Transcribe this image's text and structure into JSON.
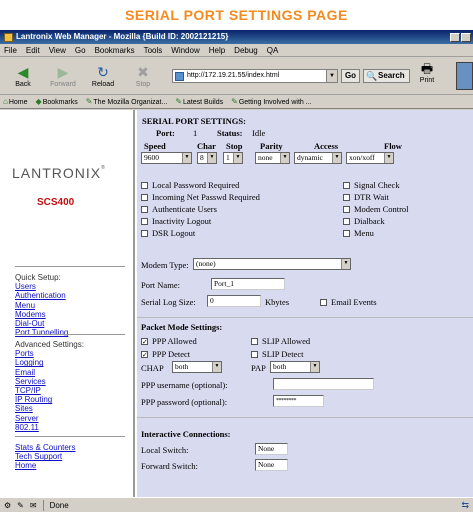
{
  "banner": "SERIAL PORT SETTINGS PAGE",
  "window": {
    "title": "Lantronix Web Manager - Mozilla {Build ID: 2002121215}"
  },
  "menu": [
    "File",
    "Edit",
    "View",
    "Go",
    "Bookmarks",
    "Tools",
    "Window",
    "Help",
    "Debug",
    "QA"
  ],
  "toolbar": {
    "back": "Back",
    "forward": "Forward",
    "reload": "Reload",
    "stop": "Stop",
    "url": "http://172.19.21.55/index.html",
    "go": "Go",
    "search": "Search",
    "print": "Print"
  },
  "bookmarks": [
    "Home",
    "Bookmarks",
    "The Mozilla Organizat...",
    "Latest Builds",
    "Getting Involved with ..."
  ],
  "sidebar": {
    "logo": "LANTRONIX",
    "model": "SCS400",
    "quick_setup": {
      "heading": "Quick Setup:",
      "links": [
        "Users",
        "Authentication",
        "Menu",
        "Modems",
        "Dial-Out",
        "Port Tunnelling"
      ]
    },
    "advanced": {
      "heading": "Advanced Settings:",
      "links": [
        "Ports",
        "Logging",
        "Email",
        "Services",
        "TCP/IP",
        "IP Routing",
        "Sites",
        "Server",
        "802.11"
      ]
    },
    "extra_links": [
      "Stats & Counters",
      "Tech Support",
      "Home"
    ]
  },
  "form": {
    "title": "SERIAL PORT SETTINGS:",
    "port_label": "Port:",
    "port_value": "1",
    "status_label": "Status:",
    "status_value": "Idle",
    "col_speed": "Speed",
    "col_char": "Char",
    "col_stop": "Stop",
    "col_parity": "Parity",
    "col_access": "Access",
    "col_flow": "Flow",
    "speed": "9600",
    "char": "8",
    "stop": "1",
    "parity": "none",
    "access": "dynamic",
    "flow": "xon/xoff",
    "checks_left": [
      {
        "label": "Local Password Required",
        "checked": false
      },
      {
        "label": "Incoming Net Passwd Required",
        "checked": false
      },
      {
        "label": "Authenticate Users",
        "checked": false
      },
      {
        "label": "Inactivity Logout",
        "checked": false
      },
      {
        "label": "DSR Logout",
        "checked": false
      }
    ],
    "checks_right": [
      {
        "label": "Signal Check",
        "checked": false
      },
      {
        "label": "DTR Wait",
        "checked": false
      },
      {
        "label": "Modem Control",
        "checked": false
      },
      {
        "label": "Dialback",
        "checked": false
      },
      {
        "label": "Menu",
        "checked": false
      }
    ],
    "modem_type_label": "Modem Type:",
    "modem_type": "(none)",
    "port_name_label": "Port Name:",
    "port_name": "Port_1",
    "log_size_label": "Serial Log Size:",
    "log_size": "0",
    "log_unit": "Kbytes",
    "email_events": "Email Events",
    "packet_title": "Packet Mode Settings:",
    "ppp_allowed": "PPP Allowed",
    "slip_allowed": "SLIP Allowed",
    "ppp_detect": "PPP Detect",
    "slip_detect": "SLIP Detect",
    "chap_label": "CHAP",
    "chap": "both",
    "pap_label": "PAP",
    "pap": "both",
    "ppp_user_label": "PPP username (optional):",
    "ppp_user": "",
    "ppp_pass_label": "PPP password (optional):",
    "ppp_pass": "********",
    "interactive_title": "Interactive Connections:",
    "local_switch_label": "Local Switch:",
    "local_switch": "None",
    "forward_switch_label": "Forward Switch:",
    "forward_switch": "None"
  },
  "status": {
    "text": "Done"
  }
}
